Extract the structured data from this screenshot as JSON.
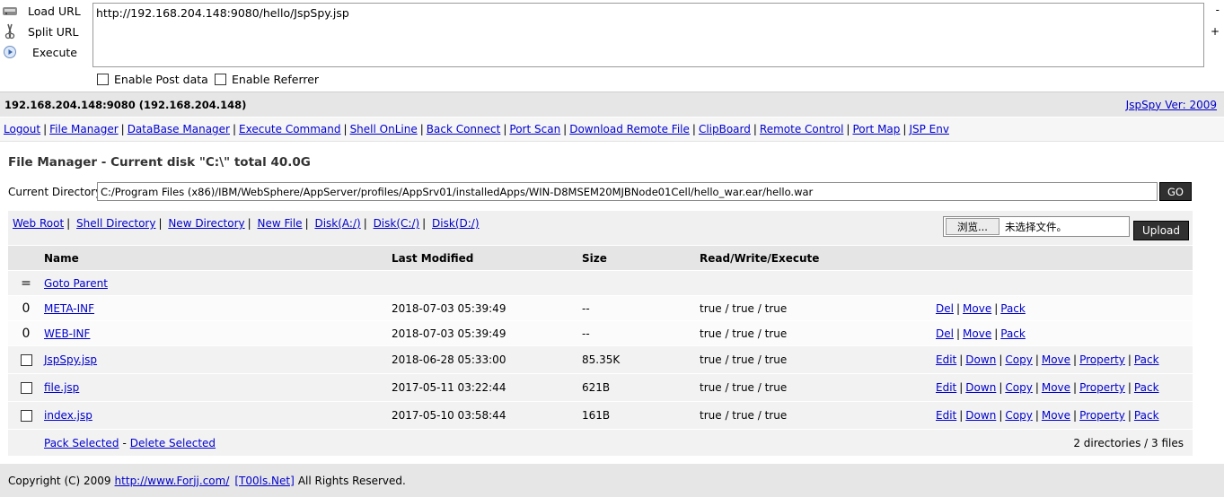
{
  "hackbar": {
    "load_url": "Load URL",
    "split_url": "Split URL",
    "execute": "Execute",
    "url_value": "http://192.168.204.148:9080/hello/JspSpy.jsp",
    "minus": "-",
    "plus": "+",
    "enable_post": "Enable Post data",
    "enable_referrer": "Enable Referrer"
  },
  "header": {
    "host": "192.168.204.148:9080 (192.168.204.148)",
    "version": "JspSpy Ver: 2009"
  },
  "nav": {
    "items": [
      "Logout",
      "File Manager",
      "DataBase Manager",
      "Execute Command",
      "Shell OnLine",
      "Back Connect",
      "Port Scan",
      "Download Remote File",
      "ClipBoard",
      "Remote Control",
      "Port Map",
      "JSP Env"
    ],
    "separator": "|"
  },
  "file_manager": {
    "title": "File Manager - Current disk \"C:\\\" total 40.0G",
    "current_dir_label": "Current Directory",
    "current_dir_value": "C:/Program Files (x86)/IBM/WebSphere/AppServer/profiles/AppSrv01/installedApps/WIN-D8MSEM20MJBNode01Cell/hello_war.ear/hello.war",
    "go_label": "GO",
    "tool_links": [
      "Web Root",
      "Shell Directory",
      "New Directory",
      "New File",
      "Disk(A:/)",
      "Disk(C:/)",
      "Disk(D:/)"
    ],
    "browse_label": "浏览...",
    "no_file_label": "未选择文件。",
    "upload_label": "Upload"
  },
  "table": {
    "headers": {
      "name": "Name",
      "modified": "Last Modified",
      "size": "Size",
      "rwx": "Read/Write/Execute"
    },
    "goto_parent": {
      "icon": "=",
      "label": "Goto Parent"
    },
    "dirs": [
      {
        "icon": "0",
        "name": "META-INF",
        "modified": "2018-07-03 05:39:49",
        "size": "--",
        "rwx": "true / true / true",
        "actions": [
          "Del",
          "Move",
          "Pack"
        ]
      },
      {
        "icon": "0",
        "name": "WEB-INF",
        "modified": "2018-07-03 05:39:49",
        "size": "--",
        "rwx": "true / true / true",
        "actions": [
          "Del",
          "Move",
          "Pack"
        ]
      }
    ],
    "files": [
      {
        "name": "JspSpy.jsp",
        "modified": "2018-06-28 05:33:00",
        "size": "85.35K",
        "rwx": "true / true / true",
        "actions": [
          "Edit",
          "Down",
          "Copy",
          "Move",
          "Property",
          "Pack"
        ]
      },
      {
        "name": "file.jsp",
        "modified": "2017-05-11 03:22:44",
        "size": "621B",
        "rwx": "true / true / true",
        "actions": [
          "Edit",
          "Down",
          "Copy",
          "Move",
          "Property",
          "Pack"
        ]
      },
      {
        "name": "index.jsp",
        "modified": "2017-05-10 03:58:44",
        "size": "161B",
        "rwx": "true / true / true",
        "actions": [
          "Edit",
          "Down",
          "Copy",
          "Move",
          "Property",
          "Pack"
        ]
      }
    ],
    "footer": {
      "pack_selected": "Pack Selected",
      "dash": "-",
      "delete_selected": "Delete Selected",
      "summary": "2 directories / 3 files"
    }
  },
  "copyright": {
    "prefix": "Copyright (C) 2009",
    "link1": "http://www.Forjj.com/",
    "link2": "[T00ls.Net]",
    "suffix": "All Rights Reserved."
  }
}
